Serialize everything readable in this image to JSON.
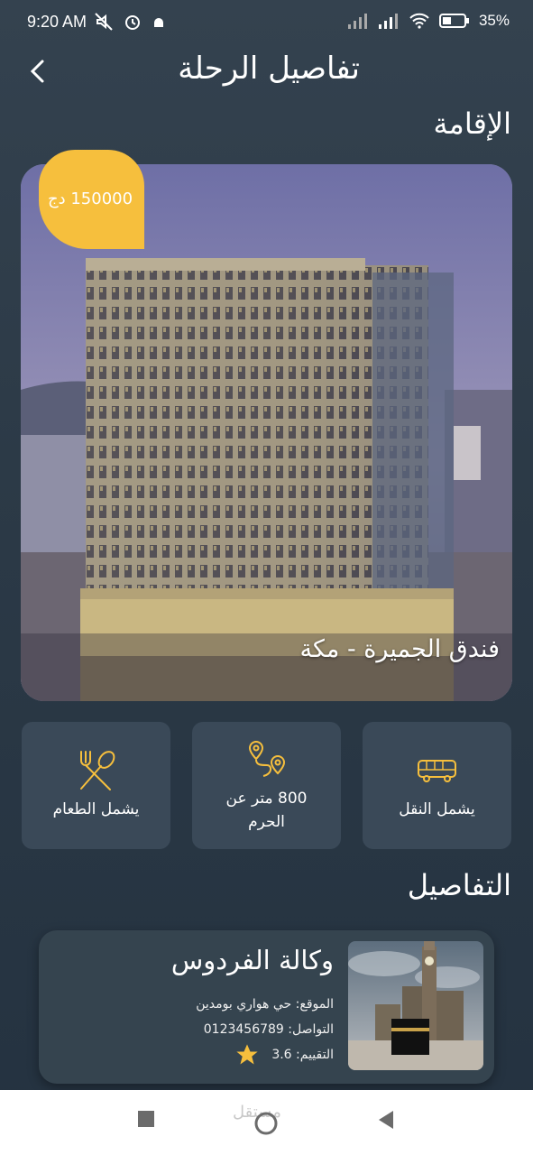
{
  "status_bar": {
    "time": "9:20 AM",
    "battery_percent": "35%"
  },
  "header": {
    "title": "تفاصيل الرحلة"
  },
  "accommodation": {
    "section_title": "الإقامة",
    "price": "150000 دج",
    "hotel_name": "فندق الجميرة - مكة"
  },
  "features": [
    {
      "label": "يشمل النقل",
      "icon": "bus-icon"
    },
    {
      "label_line1": "800 متر عن",
      "label_line2": "الحرم",
      "icon": "route-pin-icon"
    },
    {
      "label": "يشمل الطعام",
      "icon": "fork-spoon-icon"
    }
  ],
  "details": {
    "section_title": "التفاصيل"
  },
  "agency": {
    "name": "وكالة الفردوس",
    "location": "الموقع: حي هواري بومدين",
    "contact": "التواصل: 0123456789",
    "rating": "التقييم: 3.6"
  },
  "watermark": "مستقل",
  "colors": {
    "accent": "#f6bf3d",
    "card_bg": "#3a4958",
    "page_bg": "#2c3a47"
  }
}
